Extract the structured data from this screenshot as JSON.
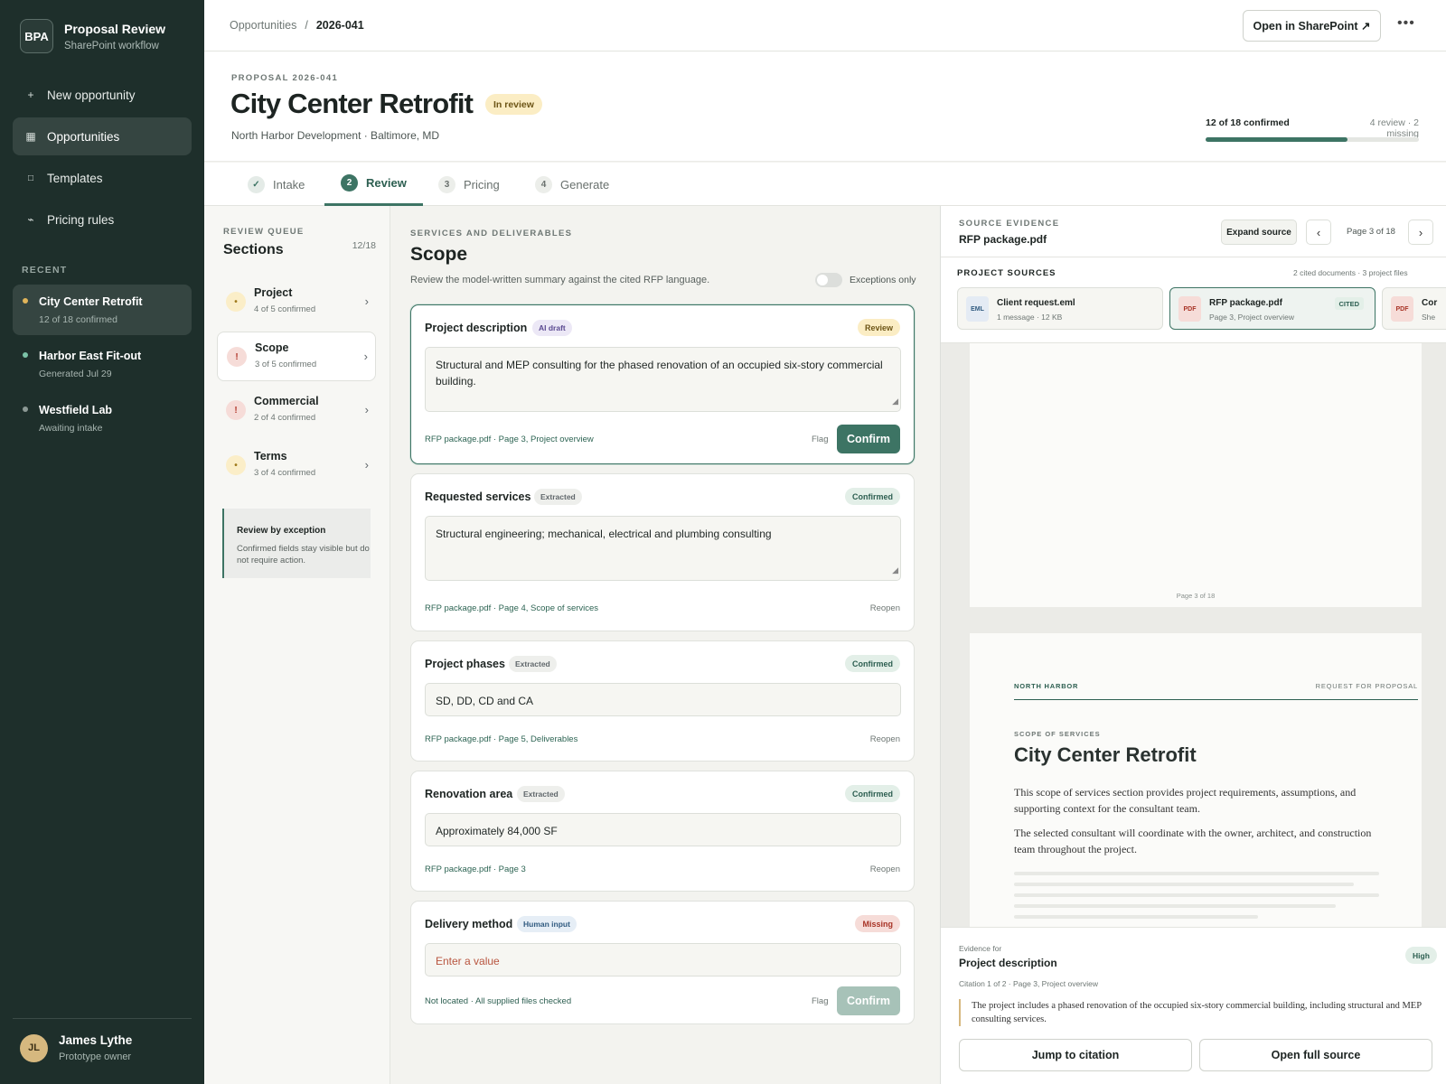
{
  "app": {
    "logo": "BPA",
    "title": "Proposal Review",
    "subtitle": "SharePoint workflow"
  },
  "nav": [
    {
      "icon": "plus-icon",
      "label": "New opportunity"
    },
    {
      "icon": "grid-icon",
      "label": "Opportunities",
      "active": true
    },
    {
      "icon": "template-icon",
      "label": "Templates"
    },
    {
      "icon": "pricing-icon",
      "label": "Pricing rules"
    }
  ],
  "recent": {
    "heading": "RECENT",
    "items": [
      {
        "title": "City Center Retrofit",
        "sub": "12 of 18 confirmed",
        "dot_color": "#e0b45a"
      },
      {
        "title": "Harbor East Fit-out",
        "sub": "Generated Jul 29",
        "dot_color": "#7bc3a8"
      },
      {
        "title": "Westfield Lab",
        "sub": "Awaiting intake",
        "dot_color": "#8c9995"
      }
    ]
  },
  "user": {
    "initials": "JL",
    "name": "James Lythe",
    "role": "Prototype owner"
  },
  "topbar": {
    "crumb_root": "Opportunities",
    "crumb_sep": "/",
    "crumb_current": "2026-041",
    "open_sharepoint": "Open in SharePoint ↗",
    "more": "•••"
  },
  "header": {
    "eyebrow": "PROPOSAL 2026-041",
    "title": "City Center Retrofit",
    "status": "In review",
    "client": "North Harbor Development · Baltimore, MD",
    "progress_label": "12 of 18 confirmed",
    "progress_meta": "4 review · 2 missing",
    "progress_fraction": 0.667
  },
  "tabs": [
    {
      "num": "✓",
      "label": "Intake",
      "state": "done"
    },
    {
      "num": "2",
      "label": "Review",
      "state": "active"
    },
    {
      "num": "3",
      "label": "Pricing",
      "state": "todo"
    },
    {
      "num": "4",
      "label": "Generate",
      "state": "todo"
    }
  ],
  "queue": {
    "eyebrow": "REVIEW QUEUE",
    "title": "Sections",
    "count": "12/18",
    "items": [
      {
        "name": "Project",
        "sub": "4 of 5 confirmed",
        "icon": "•",
        "kind": "warn"
      },
      {
        "name": "Scope",
        "sub": "3 of 5 confirmed",
        "icon": "!",
        "kind": "err"
      },
      {
        "name": "Commercial",
        "sub": "2 of 4 confirmed",
        "icon": "!",
        "kind": "err"
      },
      {
        "name": "Terms",
        "sub": "3 of 4 confirmed",
        "icon": "•",
        "kind": "warn"
      }
    ],
    "note_title": "Review by exception",
    "note_body": "Confirmed fields stay visible but do not require action."
  },
  "section": {
    "eyebrow": "SERVICES AND DELIVERABLES",
    "title": "Scope",
    "subtitle": "Review the model-written summary against the cited RFP language.",
    "toggle_label": "Exceptions only"
  },
  "cards": [
    {
      "label": "Project description",
      "tag": "AI draft",
      "state": "Review",
      "value": "Structural and MEP consulting for the phased renovation of an occupied six-story commercial building.",
      "cite": "RFP package.pdf · Page 3, Project overview",
      "flag": "Flag",
      "confirm": "Confirm"
    },
    {
      "label": "Requested services",
      "tag": "Extracted",
      "state": "Confirmed",
      "value": "Structural engineering; mechanical, electrical and plumbing consulting",
      "cite": "RFP package.pdf · Page 4, Scope of services",
      "reopen": "Reopen"
    },
    {
      "label": "Project phases",
      "tag": "Extracted",
      "state": "Confirmed",
      "value": "SD, DD, CD and CA",
      "cite": "RFP package.pdf · Page 5, Deliverables",
      "reopen": "Reopen"
    },
    {
      "label": "Renovation area",
      "tag": "Extracted",
      "state": "Confirmed",
      "value": "Approximately 84,000 SF",
      "cite": "RFP package.pdf · Page 3",
      "reopen": "Reopen"
    },
    {
      "label": "Delivery method",
      "tag": "Human input",
      "state": "Missing",
      "placeholder": "Enter a value",
      "cite": "Not located · All supplied files checked",
      "flag": "Flag",
      "confirm": "Confirm"
    }
  ],
  "source": {
    "eyebrow": "SOURCE EVIDENCE",
    "file": "RFP package.pdf",
    "expand": "Expand source",
    "prev": "‹",
    "next": "›",
    "page": "Page 3 of 18",
    "sources_heading": "PROJECT SOURCES",
    "sources_meta": "2 cited documents · 3 project files",
    "files": [
      {
        "ico": "EML",
        "name": "Client request.eml",
        "sub": "1 message · 12 KB"
      },
      {
        "ico": "PDF",
        "name": "RFP package.pdf",
        "sub": "Page 3, Project overview",
        "badge": "CITED"
      },
      {
        "ico": "PDF",
        "name": "Cor",
        "sub": "She"
      }
    ],
    "page1_label": "Page 3 of 18",
    "doc": {
      "org": "NORTH HARBOR",
      "type": "REQUEST FOR PROPOSAL",
      "eyebrow": "SCOPE OF SERVICES",
      "title": "City Center Retrofit",
      "para1": "This scope of services section provides project requirements, assumptions, and supporting context for the consultant team.",
      "para2": "The selected consultant will coordinate with the owner, architect, and construction team throughout the project."
    }
  },
  "evidence": {
    "for": "Evidence for",
    "field": "Project description",
    "confidence": "High",
    "citation": "Citation 1 of 2 · Page 3, Project overview",
    "quote": "The project includes a phased renovation of the occupied six-story commercial building, including structural and MEP consulting services.",
    "jump": "Jump to citation",
    "open": "Open full source"
  }
}
